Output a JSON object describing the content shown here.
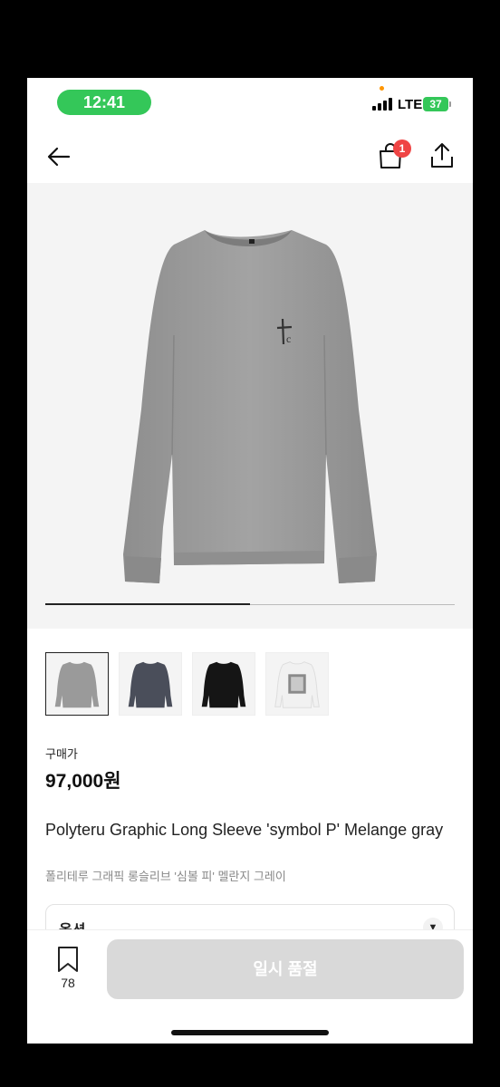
{
  "status_bar": {
    "time": "12:41",
    "network": "LTE",
    "battery": "37"
  },
  "nav": {
    "cart_count": "1",
    "icons": [
      "back-arrow-icon",
      "cart-icon",
      "share-icon"
    ]
  },
  "gallery": {
    "progress": 0.5,
    "thumbnails": [
      {
        "color": "melange-gray",
        "selected": true
      },
      {
        "color": "navy",
        "selected": false
      },
      {
        "color": "black",
        "selected": false
      },
      {
        "color": "white-graphic",
        "selected": false
      }
    ]
  },
  "product": {
    "price_label": "구매가",
    "price": "97,000원",
    "title_en": "Polyteru Graphic Long Sleeve 'symbol P' Melange gray",
    "title_ko": "폴리테루 그래픽 롱슬리브 '심볼 피' 멜란지 그레이"
  },
  "option": {
    "label": "옵션"
  },
  "bottom_bar": {
    "bookmark_count": "78",
    "button_label": "일시 품절"
  },
  "colors": {
    "accent_green": "#34c759",
    "badge_red": "#ef4444",
    "disabled_button": "#d9d9d9"
  }
}
